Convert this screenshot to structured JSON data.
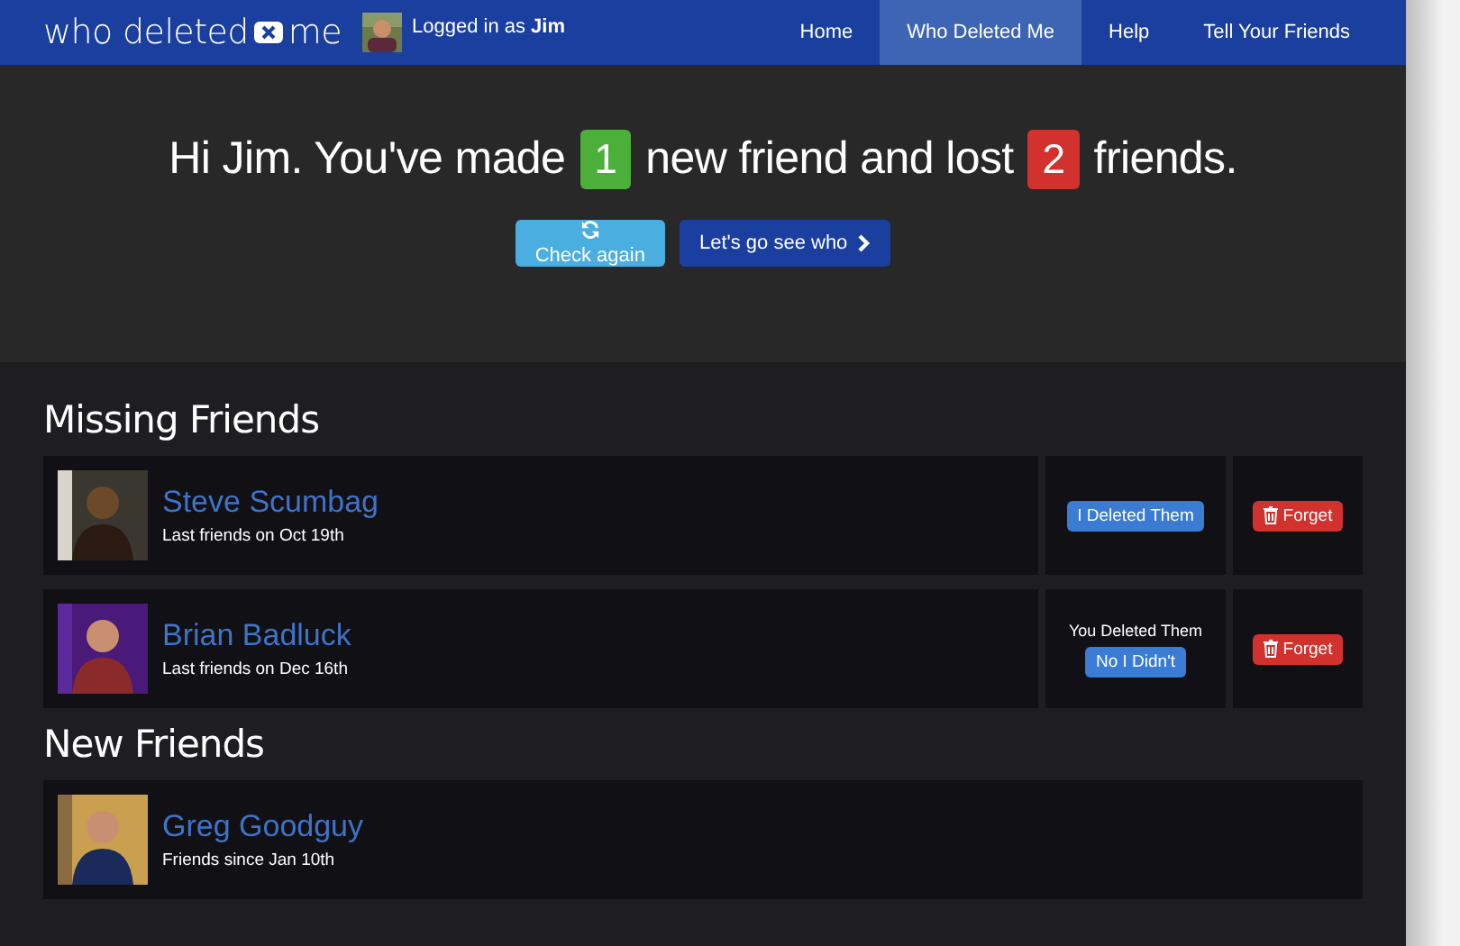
{
  "navbar": {
    "brand_before": "who deleted",
    "brand_after": "me",
    "login_text": "Logged in as ",
    "login_user": "Jim",
    "links": [
      {
        "label": "Home",
        "selected": false
      },
      {
        "label": "Who Deleted Me",
        "selected": true
      },
      {
        "label": "Help",
        "selected": false
      },
      {
        "label": "Tell Your Friends",
        "selected": false
      }
    ]
  },
  "hero": {
    "headline": [
      {
        "kind": "text",
        "text": "Hi Jim. You've made"
      },
      {
        "kind": "badge",
        "text": "1",
        "color": "#4caf3a"
      },
      {
        "kind": "text",
        "text": "new friend and lost"
      },
      {
        "kind": "badge",
        "text": "2",
        "color": "#d2322d"
      },
      {
        "kind": "text",
        "text": "friends."
      }
    ],
    "buttons": [
      {
        "kind": "refresh",
        "label": "Check again"
      },
      {
        "kind": "next",
        "label": "Let's go see who"
      }
    ]
  },
  "sections": [
    {
      "title": "Missing Friends",
      "friends": [
        {
          "name": "Steve Scumbag",
          "detail": "Last friends on Oct 19th",
          "status_button": "I Deleted Them",
          "forget": "Forget"
        },
        {
          "name": "Brian Badluck",
          "detail": "Last friends on Dec 16th",
          "status_note": "You Deleted Them",
          "status_button": "No I Didn't",
          "forget": "Forget"
        }
      ]
    },
    {
      "title": "New Friends",
      "friends": [
        {
          "name": "Greg Goodguy",
          "detail": "Friends since Jan 10th"
        }
      ]
    }
  ]
}
